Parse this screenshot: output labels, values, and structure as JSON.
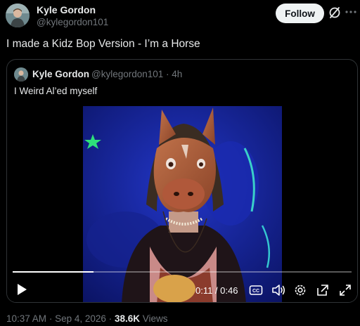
{
  "author": {
    "name": "Kyle Gordon",
    "handle": "@kylegordon101"
  },
  "actions": {
    "follow_label": "Follow"
  },
  "tweet": {
    "text": "I made a Kidz Bop Version - I’m a Horse",
    "time": "10:37 AM",
    "date": "Sep 4, 2026",
    "separator": "·",
    "views_count": "38.6K",
    "views_label": "Views"
  },
  "quote": {
    "name": "Kyle Gordon",
    "meta": "@kylegordon101 · 4h",
    "text": "I Weird Al’ed myself"
  },
  "video": {
    "time_display": "0:11 / 0:46",
    "progress": 0.239
  },
  "icons": {
    "grok": "grok-icon",
    "more": "more-icon",
    "play": "play-icon",
    "captions": "closed-captions-icon",
    "volume": "volume-icon",
    "settings": "gear-icon",
    "popout": "popout-icon",
    "fullscreen": "fullscreen-icon"
  },
  "colors": {
    "background": "#000000",
    "text_primary": "#e7e9ea",
    "text_secondary": "#71767b",
    "border": "#2f3336",
    "follow_bg": "#eff3f4"
  }
}
